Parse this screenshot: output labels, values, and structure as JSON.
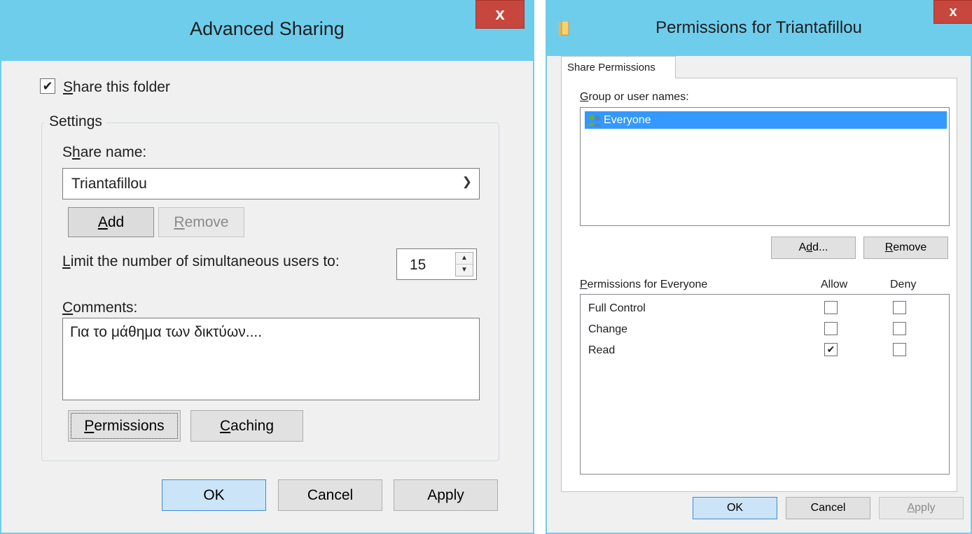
{
  "advanced_sharing": {
    "title": "Advanced Sharing",
    "close_glyph": "x",
    "share_checkbox": {
      "label_accel": "S",
      "label_rest": "hare this folder",
      "checked": true
    },
    "settings_group": "Settings",
    "share_name": {
      "label_pre": "S",
      "label_accel": "h",
      "label_post": "are name:",
      "value": "Triantafillou"
    },
    "add_button": {
      "accel": "A",
      "rest": "dd"
    },
    "remove_button": {
      "accel": "R",
      "rest": "emove"
    },
    "limit": {
      "label_accel": "L",
      "label_rest": "imit the number of simultaneous users to:",
      "value": "15"
    },
    "comments": {
      "label_accel": "C",
      "label_rest": "omments:",
      "value": "Για το μάθημα των δικτύων...."
    },
    "permissions_button": {
      "accel": "P",
      "rest": "ermissions"
    },
    "caching_button": {
      "accel": "C",
      "rest": "aching"
    },
    "ok": "OK",
    "cancel": "Cancel",
    "apply": "Apply"
  },
  "permissions_dialog": {
    "title": "Permissions for Triantafillou",
    "close_glyph": "x",
    "tab": "Share Permissions",
    "group_label": {
      "accel": "G",
      "rest": "roup or user names:"
    },
    "users": [
      {
        "name": "Everyone",
        "icon": "users-group-icon"
      }
    ],
    "add_button": {
      "pre": "A",
      "accel": "d",
      "post": "d..."
    },
    "remove_button": {
      "accel": "R",
      "rest": "emove"
    },
    "perm_header": {
      "accel": "P",
      "rest": "ermissions for Everyone"
    },
    "allow_header": "Allow",
    "deny_header": "Deny",
    "permissions": [
      {
        "name": "Full Control",
        "allow": false,
        "deny": false
      },
      {
        "name": "Change",
        "allow": false,
        "deny": false
      },
      {
        "name": "Read",
        "allow": true,
        "deny": false
      }
    ],
    "ok": "OK",
    "cancel": "Cancel",
    "apply": {
      "accel": "A",
      "rest": "pply"
    }
  },
  "colors": {
    "titlebar": "#6fcdec",
    "close": "#c7463d",
    "selection": "#3399ff",
    "default_button": "#cce4f7"
  }
}
